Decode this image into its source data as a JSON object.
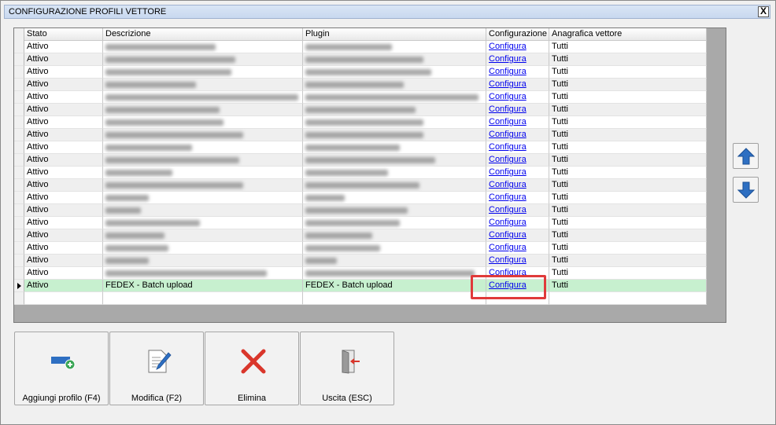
{
  "window": {
    "title": "CONFIGURAZIONE PROFILI VETTORE",
    "close_label": "X"
  },
  "grid": {
    "columns": [
      "Stato",
      "Descrizione",
      "Plugin",
      "Configurazione",
      "Anagrafica vettore"
    ],
    "rows": [
      {
        "stato": "Attivo",
        "configurazione": "Configura",
        "anagrafica": "Tutti"
      },
      {
        "stato": "Attivo",
        "configurazione": "Configura",
        "anagrafica": "Tutti"
      },
      {
        "stato": "Attivo",
        "configurazione": "Configura",
        "anagrafica": "Tutti"
      },
      {
        "stato": "Attivo",
        "configurazione": "Configura",
        "anagrafica": "Tutti"
      },
      {
        "stato": "Attivo",
        "configurazione": "Configura",
        "anagrafica": "Tutti"
      },
      {
        "stato": "Attivo",
        "configurazione": "Configura",
        "anagrafica": "Tutti"
      },
      {
        "stato": "Attivo",
        "configurazione": "Configura",
        "anagrafica": "Tutti"
      },
      {
        "stato": "Attivo",
        "configurazione": "Configura",
        "anagrafica": "Tutti"
      },
      {
        "stato": "Attivo",
        "configurazione": "Configura",
        "anagrafica": "Tutti"
      },
      {
        "stato": "Attivo",
        "configurazione": "Configura",
        "anagrafica": "Tutti"
      },
      {
        "stato": "Attivo",
        "configurazione": "Configura",
        "anagrafica": "Tutti"
      },
      {
        "stato": "Attivo",
        "configurazione": "Configura",
        "anagrafica": "Tutti"
      },
      {
        "stato": "Attivo",
        "configurazione": "Configura",
        "anagrafica": "Tutti"
      },
      {
        "stato": "Attivo",
        "configurazione": "Configura",
        "anagrafica": "Tutti"
      },
      {
        "stato": "Attivo",
        "configurazione": "Configura",
        "anagrafica": "Tutti"
      },
      {
        "stato": "Attivo",
        "configurazione": "Configura",
        "anagrafica": "Tutti"
      },
      {
        "stato": "Attivo",
        "configurazione": "Configura",
        "anagrafica": "Tutti"
      },
      {
        "stato": "Attivo",
        "configurazione": "Configura",
        "anagrafica": "Tutti"
      },
      {
        "stato": "Attivo",
        "configurazione": "Configura",
        "anagrafica": "Tutti"
      },
      {
        "stato": "Attivo",
        "descrizione": "FEDEX - Batch upload",
        "plugin": "FEDEX - Batch upload",
        "configurazione": "Configura",
        "anagrafica": "Tutti",
        "selected": true
      }
    ]
  },
  "buttons": {
    "aggiungi": "Aggiungi profilo (F4)",
    "modifica": "Modifica (F2)",
    "elimina": "Elimina",
    "uscita": "Uscita (ESC)"
  },
  "icons": {
    "move_up": "arrow-up-icon",
    "move_down": "arrow-down-icon",
    "add": "add-profile-icon",
    "edit": "edit-document-icon",
    "delete": "delete-x-icon",
    "exit": "exit-door-icon"
  },
  "colors": {
    "selected_row": "#c7f0cf",
    "highlight": "#e03a3a",
    "arrow_blue": "#2e6fc2",
    "delete_red": "#d9362b"
  }
}
